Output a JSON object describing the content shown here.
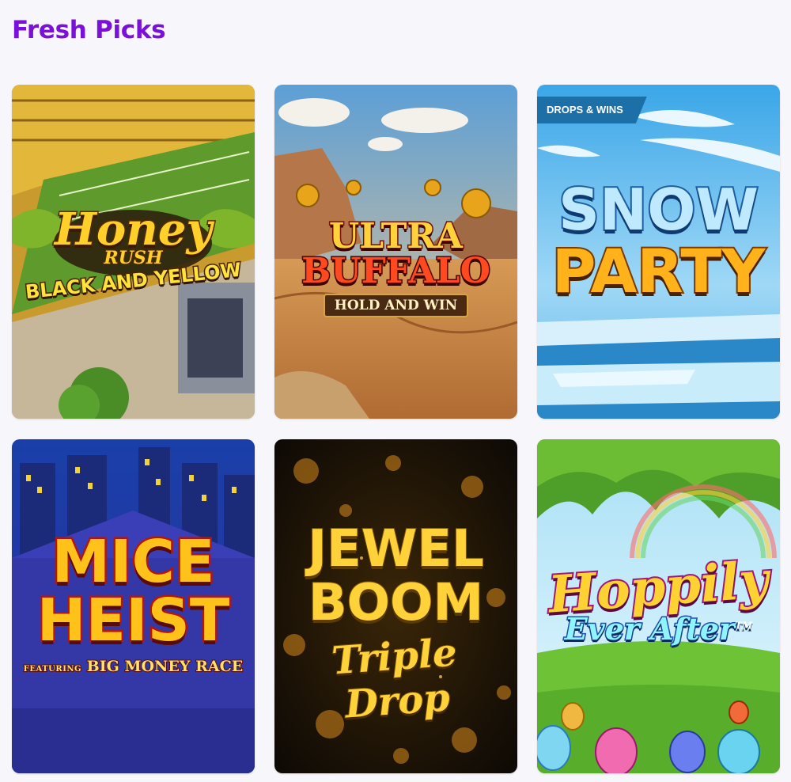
{
  "section": {
    "title": "Fresh Picks"
  },
  "games": [
    {
      "name": "Honey Rush Black and Yellow",
      "logo_line1": "Honey",
      "logo_line2": "RUSH",
      "logo_line3": "BLACK AND YELLOW"
    },
    {
      "name": "Ultra Buffalo Hold and Win",
      "logo_line1": "ULTRA",
      "logo_line2": "BUFFALO",
      "logo_line3": "HOLD AND WIN"
    },
    {
      "name": "Snow Party",
      "badge": "DROPS & WINS",
      "logo_line1": "SNOW",
      "logo_line2": "PARTY"
    },
    {
      "name": "Mice Heist",
      "logo_line1": "MICE",
      "logo_line2": "HEIST",
      "logo_feat_prefix": "FEATURING",
      "logo_feat": "BIG MONEY RACE"
    },
    {
      "name": "Jewel Boom Triple Drop",
      "logo_line1": "JEWEL",
      "logo_line2": "BOOM",
      "logo_line3": "Triple Drop"
    },
    {
      "name": "Hoppily Ever After",
      "logo_line1": "Hoppily",
      "logo_line2": "Ever After",
      "logo_tm": "TM"
    }
  ],
  "colors": {
    "title": "#7a10d9",
    "background": "#f7f6fa",
    "badge": "#1d6fa8"
  }
}
